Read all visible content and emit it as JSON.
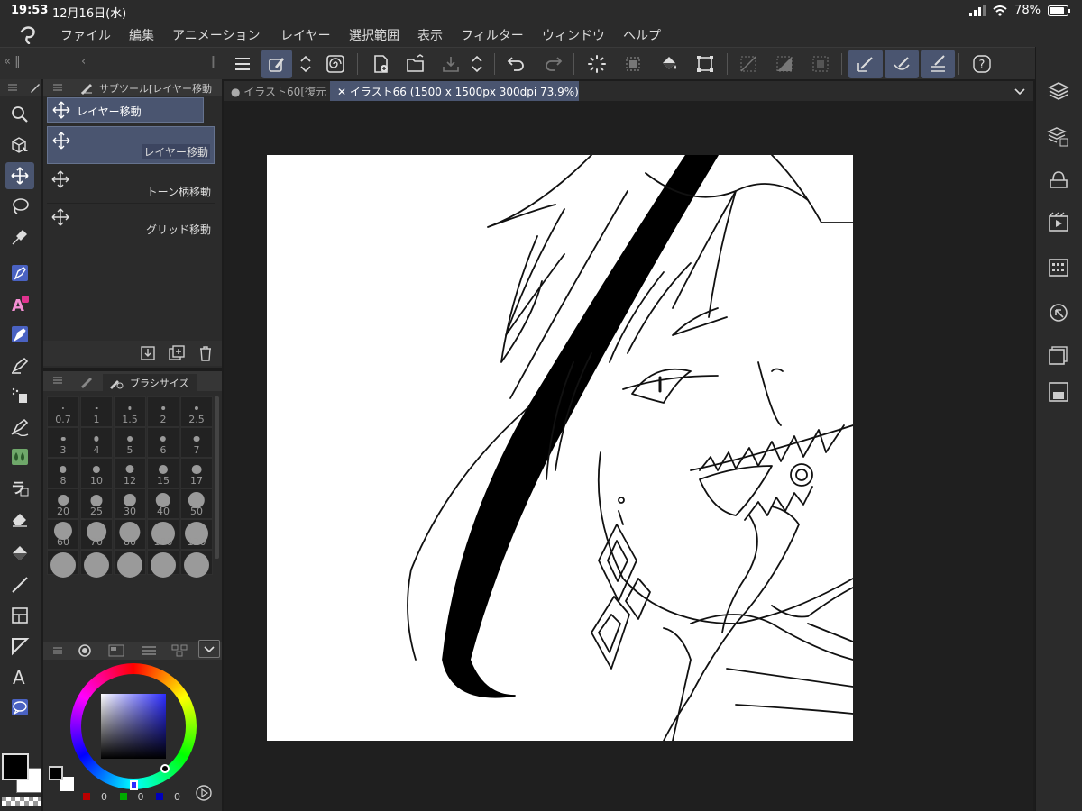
{
  "status": {
    "time": "19:53",
    "date": "12月16日(水)",
    "battery": "78%"
  },
  "menu": [
    "ファイル",
    "編集",
    "アニメーション",
    "レイヤー",
    "選択範囲",
    "表示",
    "フィルター",
    "ウィンドウ",
    "ヘルプ"
  ],
  "subtool": {
    "header": "サブツール[レイヤー移動",
    "current": "レイヤー移動",
    "items": [
      "レイヤー移動",
      "トーン柄移動",
      "グリッド移動"
    ]
  },
  "brushsize": {
    "tab": "ブラシサイズ",
    "sizes": [
      "0.7",
      "1",
      "1.5",
      "2",
      "2.5",
      "3",
      "4",
      "5",
      "6",
      "7",
      "8",
      "10",
      "12",
      "15",
      "17",
      "20",
      "25",
      "30",
      "40",
      "50",
      "60",
      "70",
      "80",
      "100",
      "120"
    ]
  },
  "color": {
    "r": "0",
    "g": "0",
    "b": "0",
    "main": "#000000",
    "sub": "#ffffff",
    "accent": "#4a5570"
  },
  "doctabs": {
    "tab1": "● イラスト60[復元",
    "tab2": "✕ イラスト66 (1500 x 1500px 300dpi 73.9%)"
  }
}
